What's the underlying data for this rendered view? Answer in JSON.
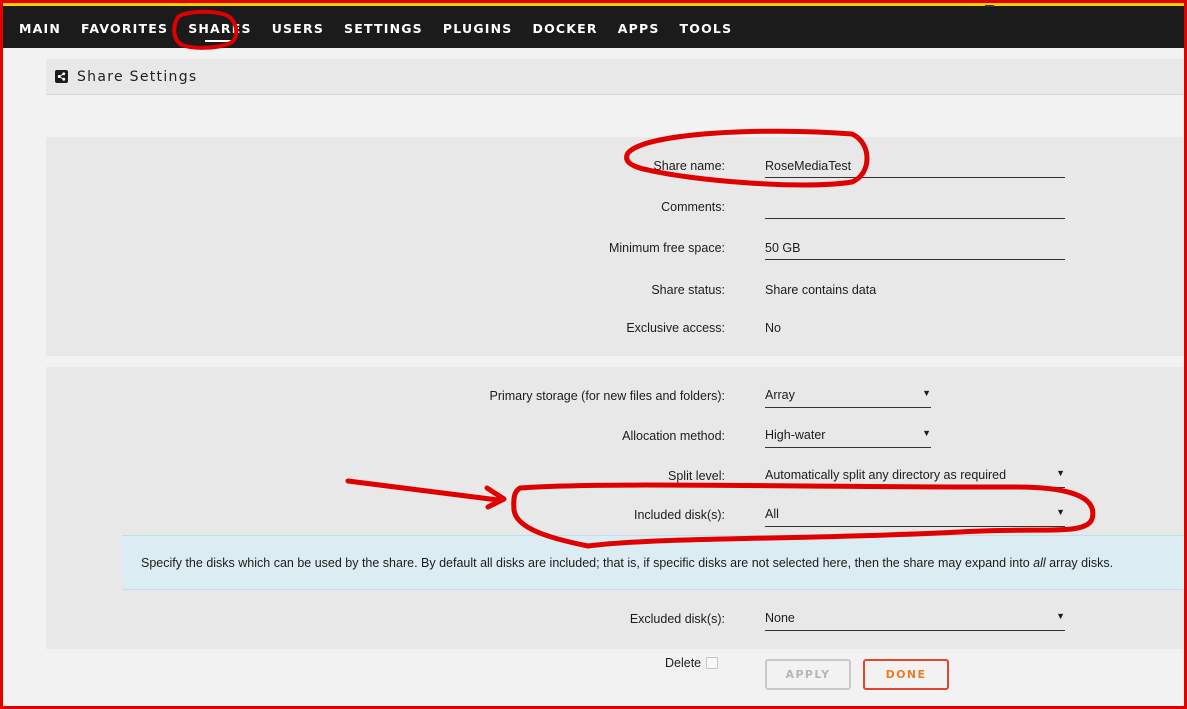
{
  "nav": {
    "items": [
      {
        "label": "MAIN"
      },
      {
        "label": "FAVORITES"
      },
      {
        "label": "SHARES"
      },
      {
        "label": "USERS"
      },
      {
        "label": "SETTINGS"
      },
      {
        "label": "PLUGINS"
      },
      {
        "label": "DOCKER"
      },
      {
        "label": "APPS"
      },
      {
        "label": "TOOLS"
      }
    ],
    "active": "SHARES"
  },
  "header": {
    "title": "Share Settings",
    "icon": "share-icon"
  },
  "general": {
    "share_name_label": "Share name:",
    "share_name_value": "RoseMediaTest",
    "comments_label": "Comments:",
    "comments_value": "",
    "min_free_label": "Minimum free space:",
    "min_free_value": "50 GB",
    "status_label": "Share status:",
    "status_value": "Share contains data",
    "exclusive_label": "Exclusive access:",
    "exclusive_value": "No"
  },
  "storage": {
    "primary_label": "Primary storage (for new files and folders):",
    "primary_value": "Array",
    "allocation_label": "Allocation method:",
    "allocation_value": "High-water",
    "split_label": "Split level:",
    "split_value": "Automatically split any directory as required",
    "included_label": "Included disk(s):",
    "included_value": "All",
    "help_before": "Specify the disks which can be used by the share. By default all disks are included; that is, if specific disks are not selected here, then the share may expand into ",
    "help_em": "all",
    "help_after": " array disks.",
    "excluded_label": "Excluded disk(s):",
    "excluded_value": "None"
  },
  "footer": {
    "delete_label": "Delete",
    "apply_label": "APPLY",
    "done_label": "DONE"
  },
  "colors": {
    "annotation": "#e00000",
    "navbar": "#1c1b1b",
    "done_border": "#e8442a",
    "done_text": "#ee7b22"
  }
}
